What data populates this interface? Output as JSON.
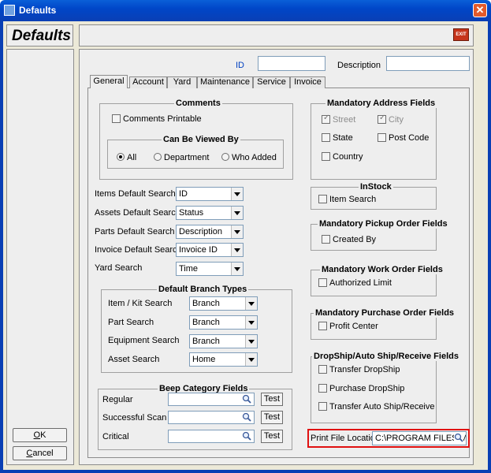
{
  "window": {
    "title": "Defaults",
    "close_glyph": "✕",
    "icon": "app-icon"
  },
  "header": {
    "title": "Defaults",
    "exit_label": "EXIT"
  },
  "sidebar": {
    "ok_label": "OK",
    "ok_mnemonic": "O",
    "ok_rest": "K",
    "cancel_label": "Cancel",
    "cancel_mnemonic": "C",
    "cancel_rest": "ancel"
  },
  "top_fields": {
    "id_label": "ID",
    "id_value": "",
    "description_label": "Description",
    "description_value": ""
  },
  "tabs": [
    {
      "label": "General",
      "active": true
    },
    {
      "label": "Account",
      "active": false
    },
    {
      "label": "Yard",
      "active": false
    },
    {
      "label": "Maintenance",
      "active": false
    },
    {
      "label": "Service",
      "active": false
    },
    {
      "label": "Invoice",
      "active": false
    }
  ],
  "comments": {
    "title": "Comments",
    "printable_label": "Comments Printable",
    "printable_checked": false,
    "viewed_by": {
      "title": "Can Be Viewed By",
      "options": [
        "All",
        "Department",
        "Who Added"
      ],
      "selected": "All"
    }
  },
  "searches": [
    {
      "label": "Items Default Search",
      "value": "ID"
    },
    {
      "label": "Assets Default Search",
      "value": "Status"
    },
    {
      "label": "Parts Default Search",
      "value": "Description"
    },
    {
      "label": "Invoice Default Search",
      "value": "Invoice ID"
    },
    {
      "label": "Yard Search",
      "value": "Time"
    }
  ],
  "branch_types": {
    "title": "Default Branch Types",
    "rows": [
      {
        "label": "Item / Kit Search",
        "value": "Branch"
      },
      {
        "label": "Part Search",
        "value": "Branch"
      },
      {
        "label": "Equipment Search",
        "value": "Branch"
      },
      {
        "label": "Asset Search",
        "value": "Home"
      }
    ]
  },
  "beep": {
    "title": "Beep Category Fields",
    "test_label": "Test",
    "rows": [
      {
        "label": "Regular",
        "value": ""
      },
      {
        "label": "Successful Scan",
        "value": ""
      },
      {
        "label": "Critical",
        "value": ""
      }
    ]
  },
  "mandatory_address": {
    "title": "Mandatory Address Fields",
    "street": "Street",
    "city": "City",
    "state": "State",
    "post_code": "Post Code",
    "country": "Country"
  },
  "instock": {
    "title": "InStock",
    "item_search": "Item Search"
  },
  "pickup": {
    "title": "Mandatory Pickup Order Fields",
    "created_by": "Created By"
  },
  "work_order": {
    "title": "Mandatory Work Order Fields",
    "authorized_limit": "Authorized Limit"
  },
  "purchase_order": {
    "title": "Mandatory Purchase Order Fields",
    "profit_center": "Profit Center"
  },
  "dropship": {
    "title": "DropShip/Auto Ship/Receive Fields",
    "transfer_dropship": "Transfer DropShip",
    "purchase_dropship": "Purchase DropShip",
    "transfer_auto": "Transfer Auto Ship/Receive"
  },
  "print_file": {
    "label": "Print File Location",
    "value": "C:\\PROGRAM FILES\\MA"
  },
  "colors": {
    "title_bar": "#0046c8",
    "highlight": "#e01010",
    "label_blue": "#0040c0"
  }
}
